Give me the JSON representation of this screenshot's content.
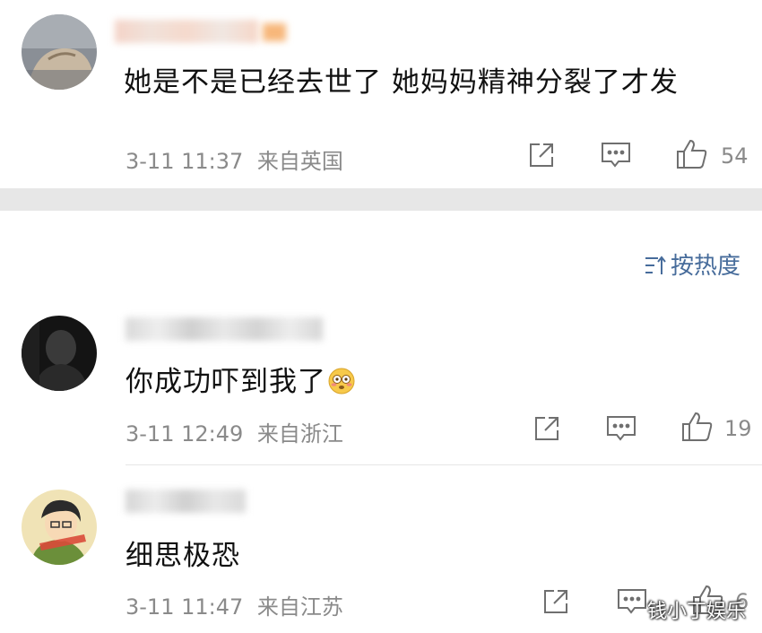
{
  "comments": [
    {
      "text": "她是不是已经去世了 她妈妈精神分裂了才发",
      "time": "3-11 11:37",
      "location": "来自英国",
      "likes": "54"
    },
    {
      "text": "你成功吓到我了",
      "emoji": "flushed-face-emoji",
      "time": "3-11 12:49",
      "location": "来自浙江",
      "likes": "19"
    },
    {
      "text": "细思极恐",
      "time": "3-11 11:47",
      "location": "来自江苏",
      "likes": "6"
    }
  ],
  "sort": {
    "label": "按热度",
    "icon": "sort-icon"
  },
  "watermark": "钱小丁娱乐",
  "colors": {
    "accent": "#476c9b",
    "meta_gray": "#8a8a8a",
    "divider": "#e7e7e7"
  },
  "icons": {
    "share": "share-icon",
    "reply": "comment-icon",
    "like": "thumbs-up-icon"
  }
}
